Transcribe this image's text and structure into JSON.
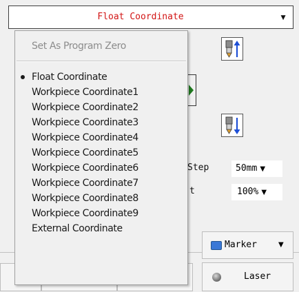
{
  "coordinate_select": {
    "value": "Float Coordinate",
    "arrow_icon": "triangle-down-icon"
  },
  "menu": {
    "header_item": "Set As Program Zero",
    "selected_index": 0,
    "items": [
      "Float Coordinate",
      "Workpiece Coordinate1",
      "Workpiece Coordinate2",
      "Workpiece Coordinate3",
      "Workpiece Coordinate4",
      "Workpiece Coordinate5",
      "Workpiece Coordinate6",
      "Workpiece Coordinate7",
      "Workpiece Coordinate8",
      "Workpiece Coordinate9",
      "External Coordinate"
    ]
  },
  "controls": {
    "step_label": "Step",
    "step_value": "50mm",
    "speed_label": "t",
    "speed_value": "100%",
    "marker_label": "Marker",
    "laser_label": "Laser"
  },
  "icons": {
    "z_up": "tool-z-up-icon",
    "z_down": "tool-z-down-icon",
    "play": "play-icon",
    "marker": "marker-swatch-icon",
    "laser": "laser-dot-icon"
  },
  "colors": {
    "title_text": "#d21414",
    "arrow_blue": "#1e4fd6",
    "marker_blue": "#3a78d6",
    "play_green": "#1f7a1f"
  }
}
